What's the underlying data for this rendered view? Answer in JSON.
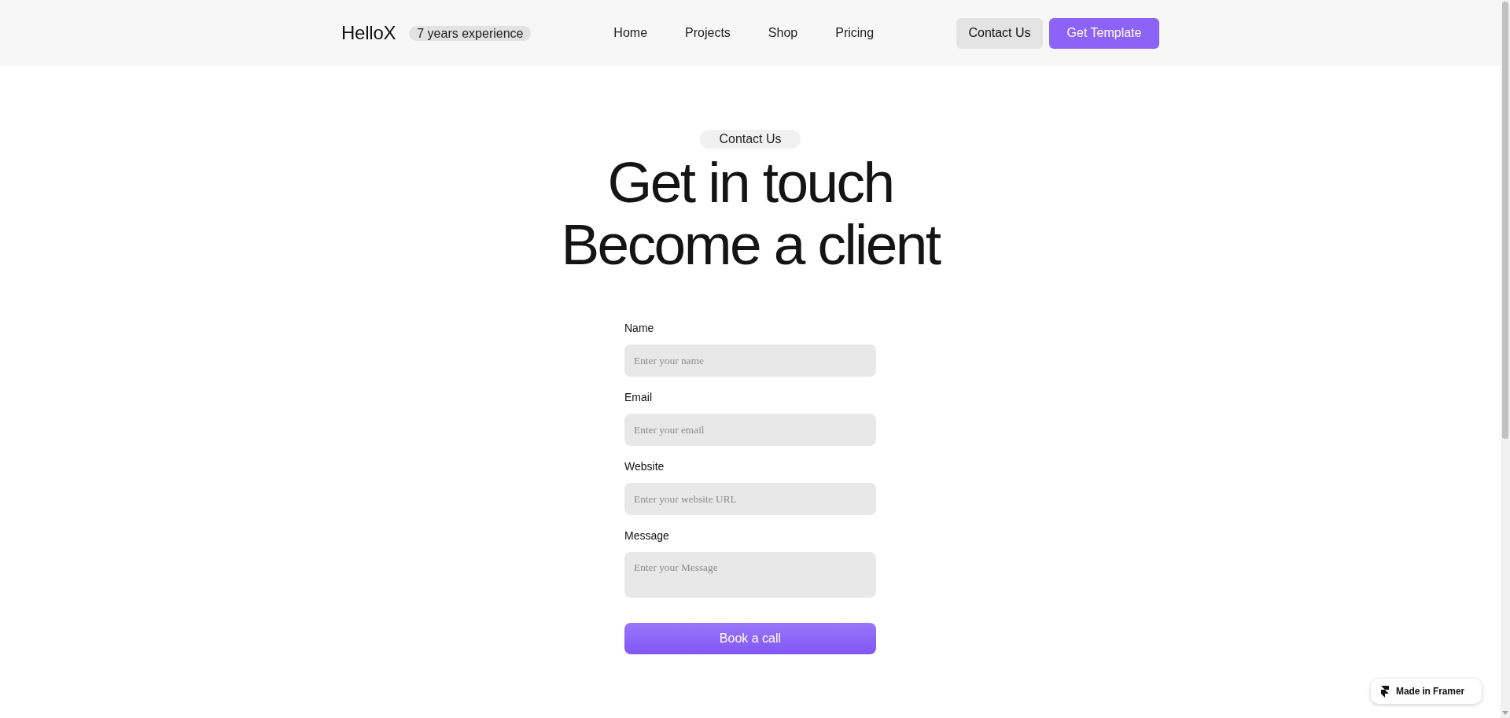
{
  "header": {
    "logo": "HelloX",
    "badge": "7 years experience",
    "nav": [
      {
        "label": "Home"
      },
      {
        "label": "Projects"
      },
      {
        "label": "Shop"
      },
      {
        "label": "Pricing"
      }
    ],
    "buttons": [
      {
        "label": "Contact Us",
        "kind": "secondary"
      },
      {
        "label": "Get Template",
        "kind": "primary"
      }
    ]
  },
  "hero": {
    "eyebrow": "Contact Us",
    "title_lines": [
      "Get in touch",
      "Become a client"
    ]
  },
  "form": {
    "fields": [
      {
        "label": "Name",
        "placeholder": "Enter your name",
        "kind": "input"
      },
      {
        "label": "Email",
        "placeholder": "Enter your email",
        "kind": "input"
      },
      {
        "label": "Website",
        "placeholder": "Enter your website URL",
        "kind": "input"
      },
      {
        "label": "Message",
        "placeholder": "Enter your Message",
        "kind": "textarea"
      }
    ],
    "submit": "Book a call"
  },
  "framer_badge": {
    "label": "Made in Framer"
  }
}
